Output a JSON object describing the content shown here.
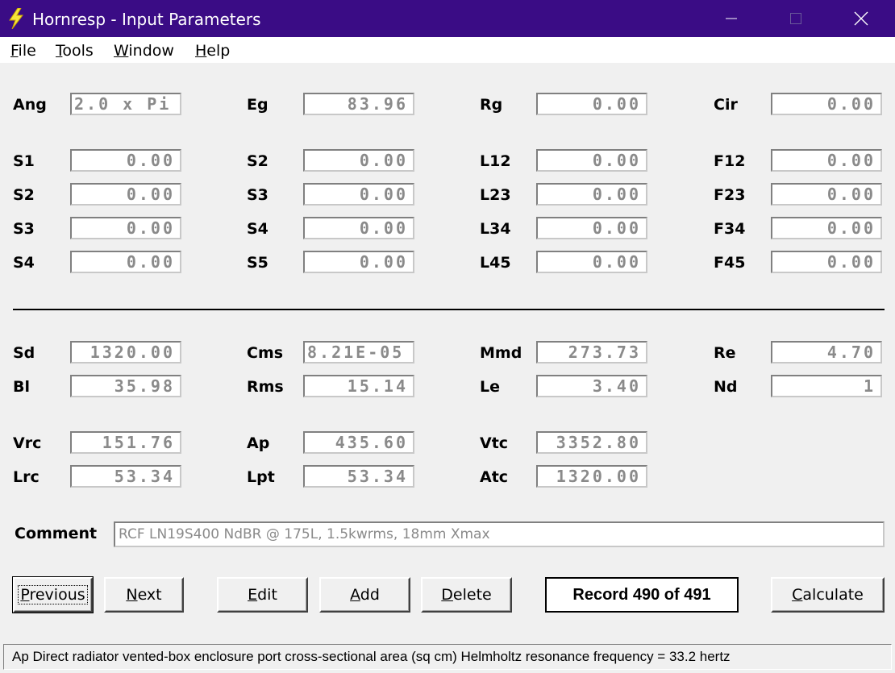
{
  "window": {
    "title": "Hornresp - Input Parameters",
    "minimize_icon": "minimize-icon",
    "maximize_icon": "maximize-icon",
    "close_icon": "close-icon",
    "title_bar_color": "#3a0c85",
    "app_icon": "lightning-bolt-icon"
  },
  "menu": [
    {
      "label_underlined": "F",
      "label_rest": "ile"
    },
    {
      "label_underlined": "T",
      "label_rest": "ools"
    },
    {
      "label_underlined": "W",
      "label_rest": "indow"
    },
    {
      "label_underlined": "H",
      "label_rest": "elp"
    }
  ],
  "top_row": {
    "ang": {
      "label": "Ang",
      "value": "2.0 x Pi"
    },
    "eg": {
      "label": "Eg",
      "value": "83.96"
    },
    "rg": {
      "label": "Rg",
      "value": "0.00"
    },
    "cir": {
      "label": "Cir",
      "value": "0.00"
    }
  },
  "horn": {
    "col1": [
      {
        "label": "S1",
        "value": "0.00"
      },
      {
        "label": "S2",
        "value": "0.00"
      },
      {
        "label": "S3",
        "value": "0.00"
      },
      {
        "label": "S4",
        "value": "0.00"
      }
    ],
    "col2": [
      {
        "label": "S2",
        "value": "0.00"
      },
      {
        "label": "S3",
        "value": "0.00"
      },
      {
        "label": "S4",
        "value": "0.00"
      },
      {
        "label": "S5",
        "value": "0.00"
      }
    ],
    "col3": [
      {
        "label": "L12",
        "value": "0.00"
      },
      {
        "label": "L23",
        "value": "0.00"
      },
      {
        "label": "L34",
        "value": "0.00"
      },
      {
        "label": "L45",
        "value": "0.00"
      }
    ],
    "col4": [
      {
        "label": "F12",
        "value": "0.00"
      },
      {
        "label": "F23",
        "value": "0.00"
      },
      {
        "label": "F34",
        "value": "0.00"
      },
      {
        "label": "F45",
        "value": "0.00"
      }
    ]
  },
  "driver": {
    "sd": {
      "label": "Sd",
      "value": "1320.00"
    },
    "cms": {
      "label": "Cms",
      "value": "8.21E-05"
    },
    "mmd": {
      "label": "Mmd",
      "value": "273.73"
    },
    "re": {
      "label": "Re",
      "value": "4.70"
    },
    "bl": {
      "label": "Bl",
      "value": "35.98"
    },
    "rms": {
      "label": "Rms",
      "value": "15.14"
    },
    "le": {
      "label": "Le",
      "value": "3.40"
    },
    "nd": {
      "label": "Nd",
      "value": "1"
    }
  },
  "chambers": {
    "vrc": {
      "label": "Vrc",
      "value": "151.76"
    },
    "ap": {
      "label": "Ap",
      "value": "435.60"
    },
    "vtc": {
      "label": "Vtc",
      "value": "3352.80"
    },
    "lrc": {
      "label": "Lrc",
      "value": "53.34"
    },
    "lpt": {
      "label": "Lpt",
      "value": "53.34"
    },
    "atc": {
      "label": "Atc",
      "value": "1320.00"
    }
  },
  "comment": {
    "label": "Comment",
    "value": "RCF LN19S400 NdBR @ 175L, 1.5kwrms, 18mm Xmax"
  },
  "buttons": {
    "previous": {
      "u": "P",
      "rest": "revious"
    },
    "next": {
      "u": "N",
      "rest": "ext"
    },
    "edit": {
      "u": "E",
      "rest": "dit"
    },
    "add": {
      "u": "A",
      "rest": "dd"
    },
    "delete": {
      "u": "D",
      "rest": "elete"
    },
    "calculate": {
      "u": "C",
      "rest": "alculate"
    }
  },
  "record": "Record 490 of 491",
  "status": "Ap   Direct radiator vented-box enclosure port cross-sectional area  (sq cm)   Helmholtz resonance frequency = 33.2 hertz"
}
